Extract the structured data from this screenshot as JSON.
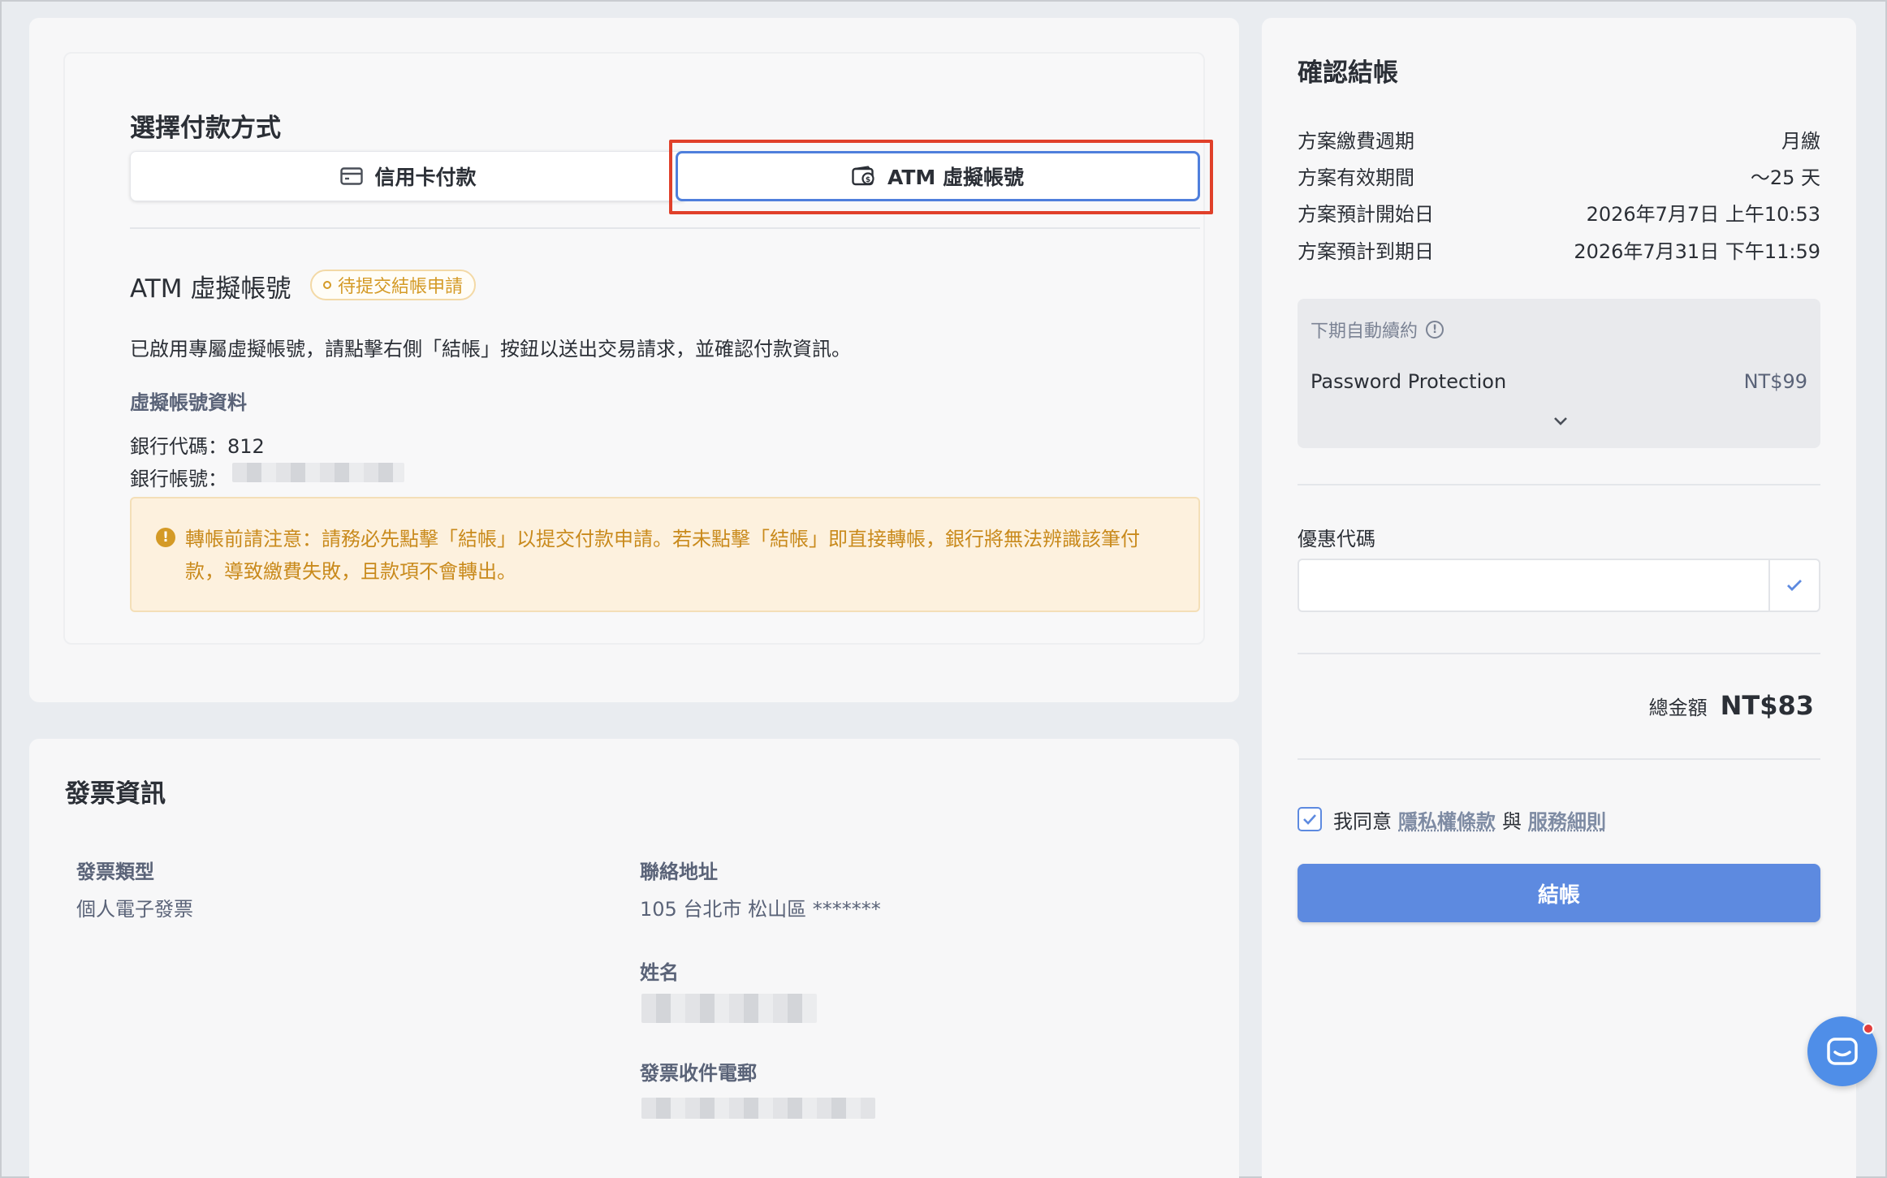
{
  "payment": {
    "title": "選擇付款方式",
    "tabs": [
      {
        "label": "信用卡付款",
        "icon": "credit-card-icon"
      },
      {
        "label": "ATM 虛擬帳號",
        "icon": "atm-wallet-icon",
        "selected": true
      }
    ],
    "atm": {
      "heading": "ATM 虛擬帳號",
      "status_badge": "待提交結帳申請",
      "description": "已啟用專屬虛擬帳號，請點擊右側「結帳」按鈕以送出交易請求，並確認付款資訊。",
      "account_section_label": "虛擬帳號資料",
      "bank_code": "銀行代碼：812",
      "bank_account_label": "銀行帳號："
    },
    "warning": "轉帳前請注意：請務必先點擊「結帳」以提交付款申請。若未點擊「結帳」即直接轉帳，銀行將無法辨識該筆付款，導致繳費失敗，且款項不會轉出。"
  },
  "invoice": {
    "title": "發票資訊",
    "type_label": "發票類型",
    "type_value": "個人電子發票",
    "address_label": "聯絡地址",
    "address_value": "105 台北市 松山區 *******",
    "name_label": "姓名",
    "email_label": "發票收件電郵"
  },
  "summary": {
    "title": "確認結帳",
    "rows": [
      {
        "label": "方案繳費週期",
        "value": "月繳"
      },
      {
        "label": "方案有效期間",
        "value": "～25 天"
      },
      {
        "label": "方案預計開始日",
        "value": "2026年7月7日 上午10:53"
      },
      {
        "label": "方案預計到期日",
        "value": "2026年7月31日 下午11:59"
      }
    ],
    "renewal": {
      "label": "下期自動續約",
      "item_name": "Password Protection",
      "item_price": "NT$99"
    },
    "coupon_label": "優惠代碼",
    "coupon_value": "",
    "total_label": "總金額",
    "total_value": "NT$83",
    "agree_prefix": "我同意",
    "privacy_link": "隱私權條款",
    "and": "與",
    "terms_link": "服務細則",
    "checkout_button": "結帳"
  },
  "colors": {
    "accent": "#5d8ae0",
    "highlight": "#e0402a",
    "warning": "#d49a26"
  }
}
